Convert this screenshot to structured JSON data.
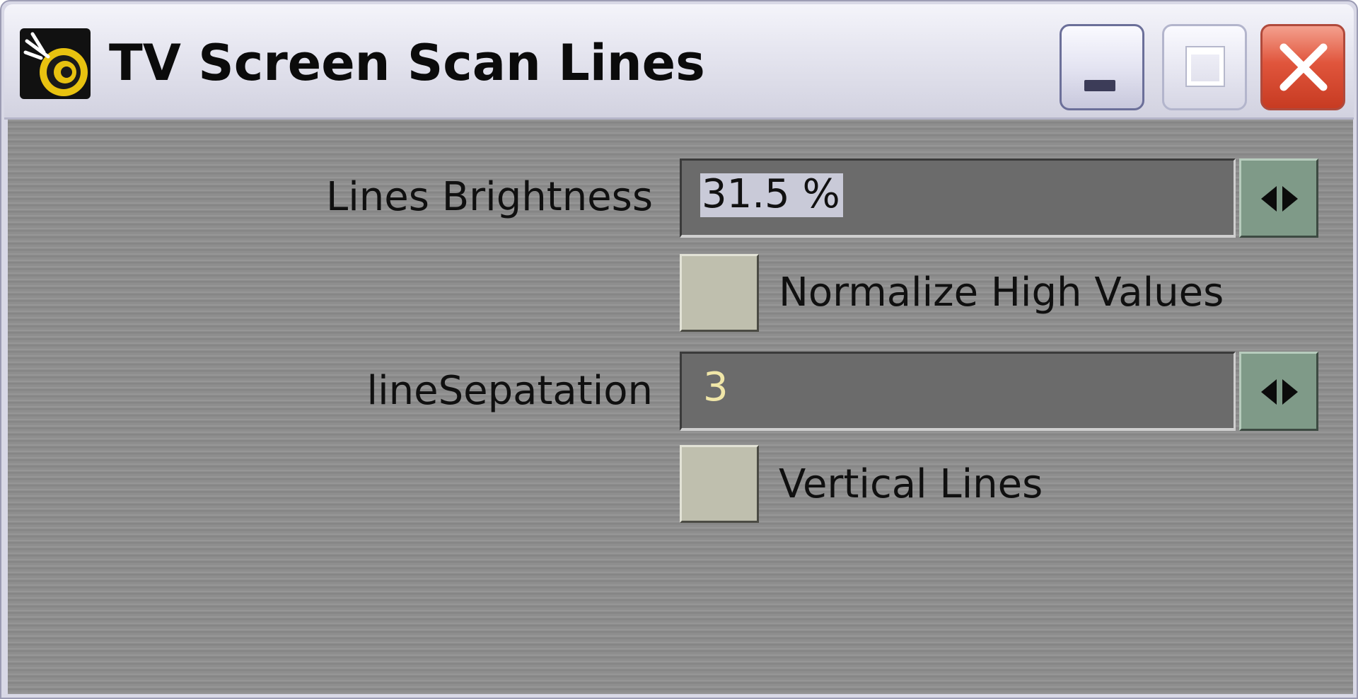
{
  "window": {
    "title": "TV Screen Scan Lines",
    "controls": {
      "minimize": "minimize",
      "maximize": "maximize",
      "close": "close"
    }
  },
  "fields": {
    "lines_brightness": {
      "label": "Lines Brightness",
      "value": "31.5 %"
    },
    "normalize_high_values": {
      "label": "Normalize High Values",
      "checked": false
    },
    "line_separation": {
      "label": "lineSepatation",
      "value": "3"
    },
    "vertical_lines": {
      "label": "Vertical Lines",
      "checked": false
    }
  },
  "icons": {
    "app": "app-icon",
    "spinner": "left-right-arrows-icon"
  },
  "colors": {
    "panel_bg": "#8e8e8e",
    "field_bg": "#6b6b6b",
    "field_value_text": "#f0e6a8",
    "spin_button": "#7f9a88",
    "checkbox": "#bfbfae",
    "close_button": "#e0553c"
  }
}
